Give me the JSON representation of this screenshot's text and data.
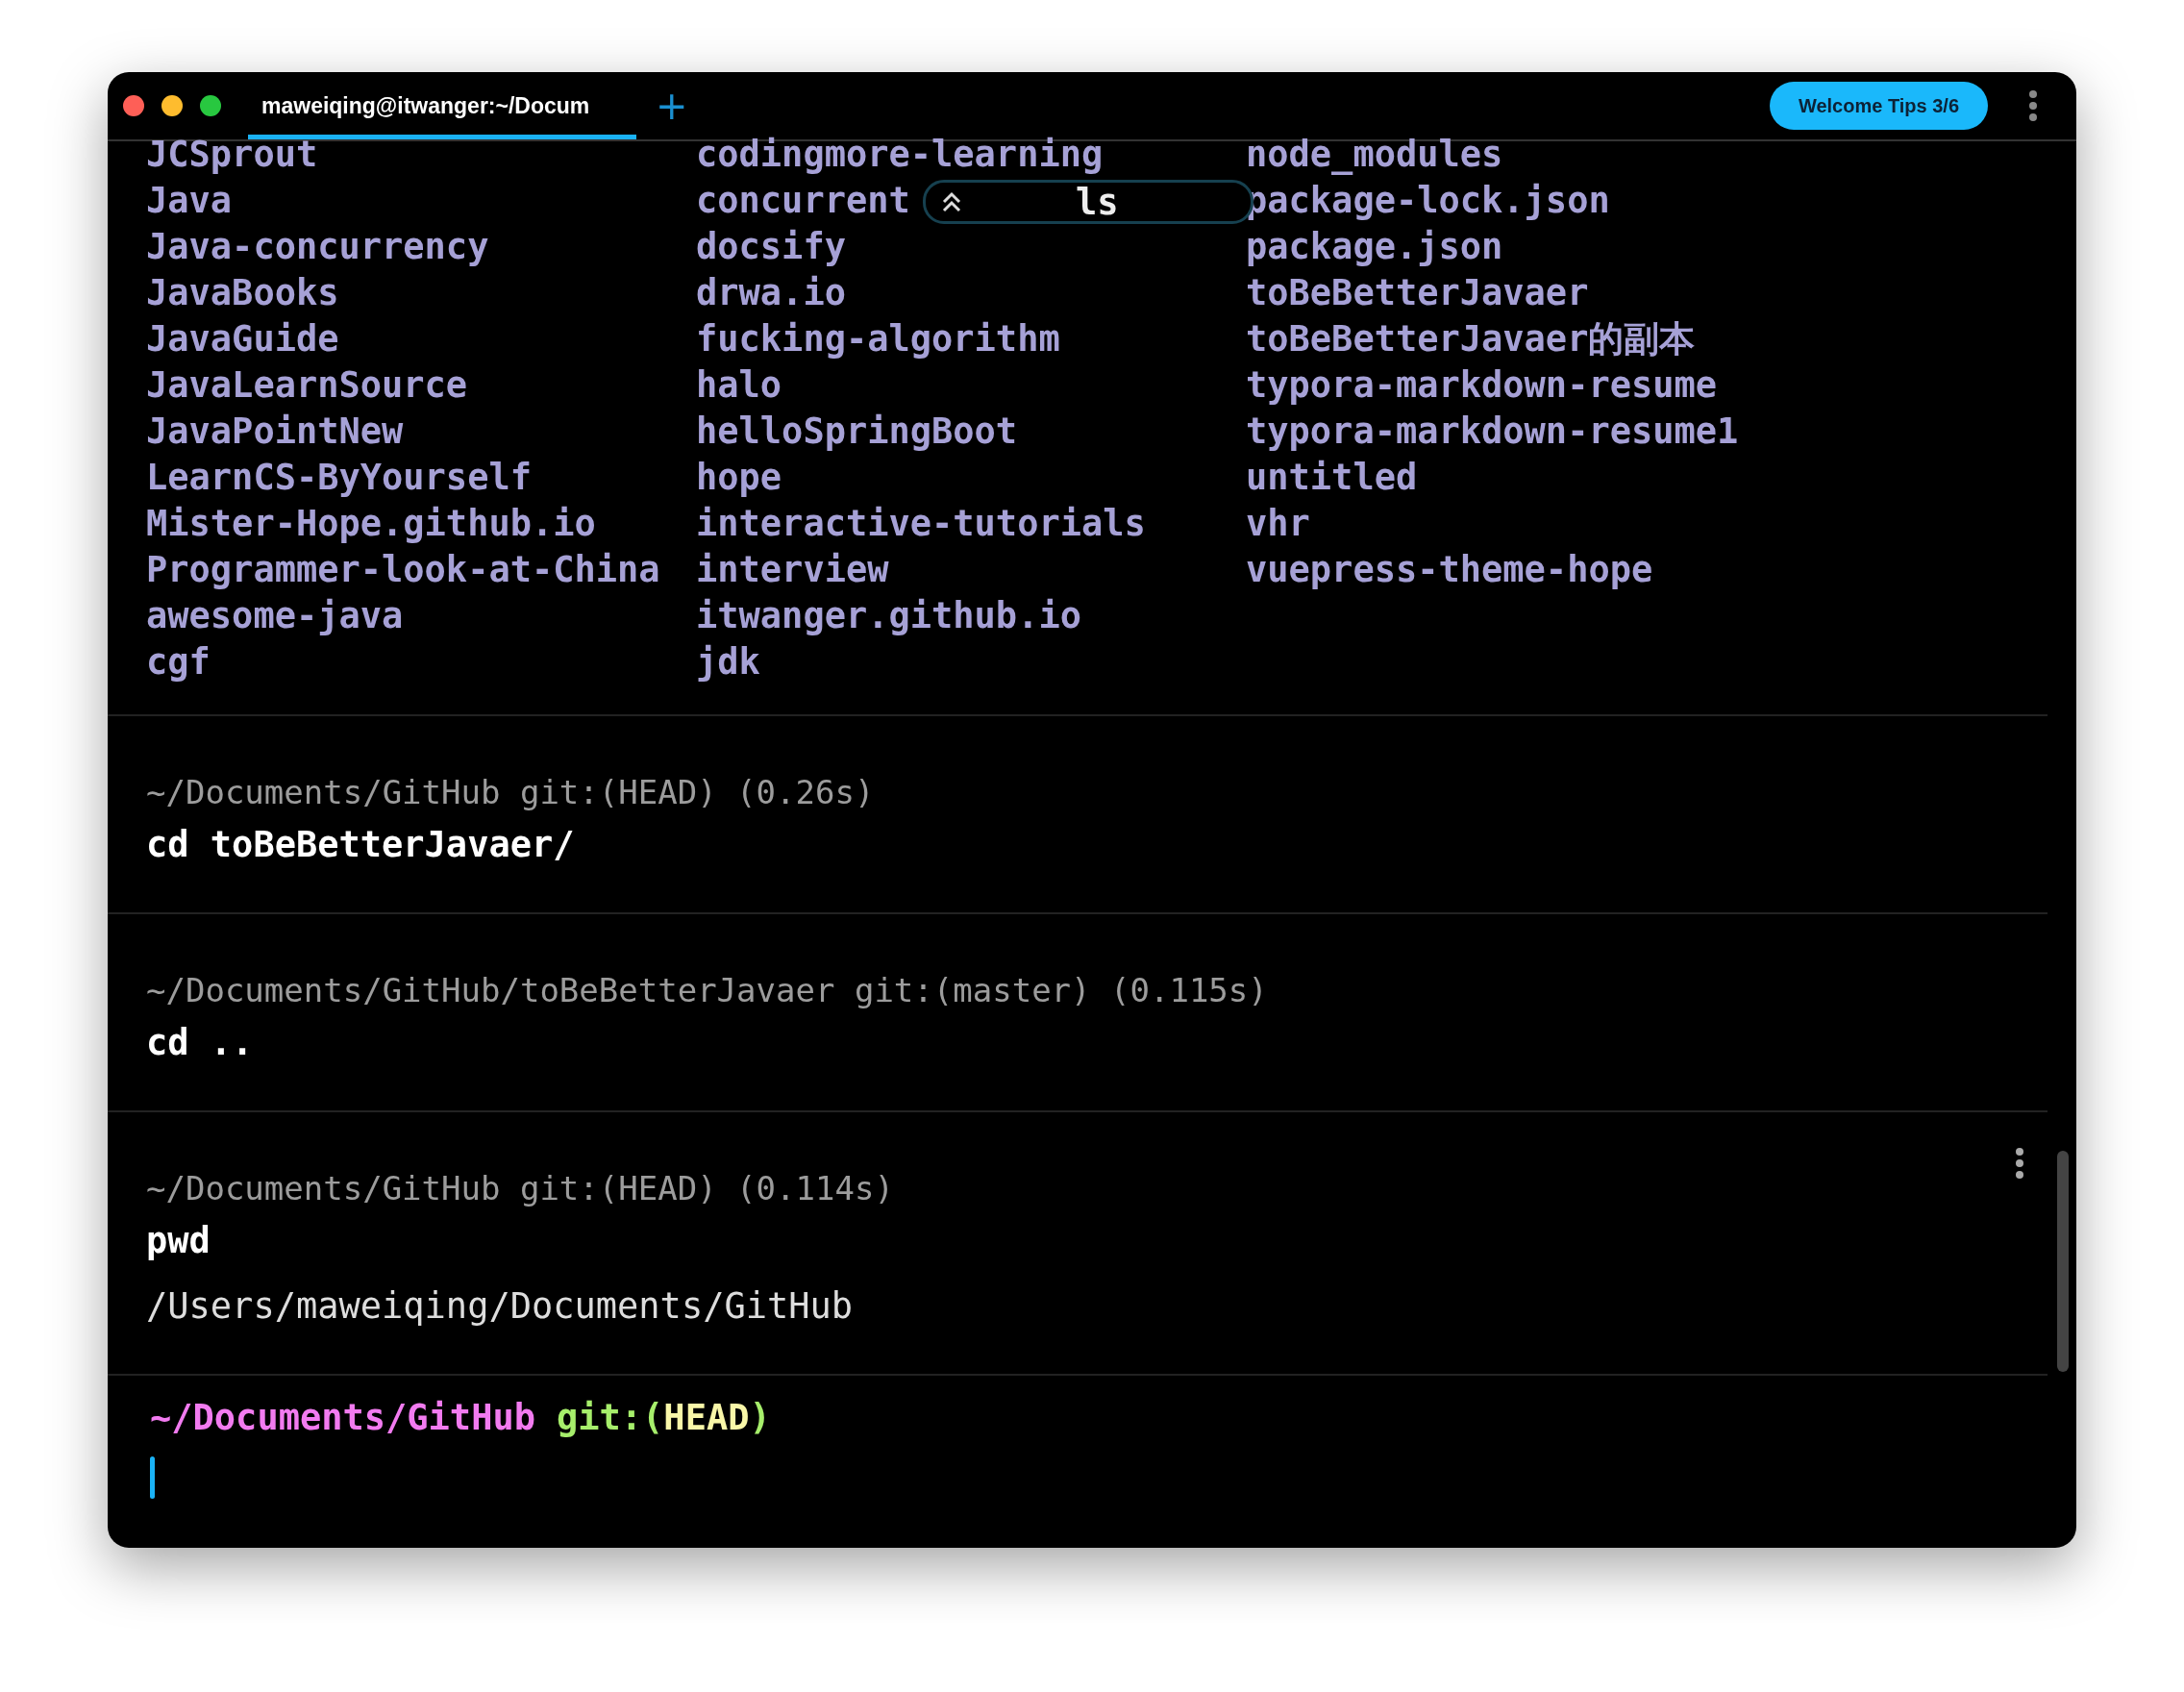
{
  "tab": {
    "title": "maweiqing@itwanger:~/Docum",
    "selected": true
  },
  "new_tab": "+",
  "tips_button": "Welcome Tips 3/6",
  "listing": {
    "columns": [
      [
        "JCSprout",
        "Java",
        "Java-concurrency",
        "JavaBooks",
        "JavaGuide",
        "JavaLearnSource",
        "JavaPointNew",
        "LearnCS-ByYourself",
        "Mister-Hope.github.io",
        "Programmer-look-at-China",
        "awesome-java",
        "cgf"
      ],
      [
        "codingmore-learning",
        "concurrent",
        "docsify",
        "drwa.io",
        "fucking-algorithm",
        "halo",
        "helloSpringBoot",
        "hope",
        "interactive-tutorials",
        "interview",
        "itwanger.github.io",
        "jdk"
      ],
      [
        "node_modules",
        "package-lock.json",
        "package.json",
        "toBeBetterJavaer",
        "toBeBetterJavaer的副本",
        "typora-markdown-resume",
        "typora-markdown-resume1",
        "untitled",
        "vhr",
        "vuepress-theme-hope"
      ]
    ]
  },
  "sticky_command": "ls",
  "blocks": [
    {
      "prompt": "~/Documents/GitHub git:(HEAD) (0.26s)",
      "command": "cd toBeBetterJavaer/"
    },
    {
      "prompt": "~/Documents/GitHub/toBeBetterJavaer git:(master) (0.115s)",
      "command": "cd .."
    },
    {
      "prompt": "~/Documents/GitHub git:(HEAD) (0.114s)",
      "command": "pwd",
      "output": "/Users/maweiqing/Documents/GitHub"
    }
  ],
  "active_prompt": {
    "path": "~/Documents/GitHub",
    "git_prefix": "git:(",
    "branch": "HEAD",
    "git_suffix": ")"
  }
}
